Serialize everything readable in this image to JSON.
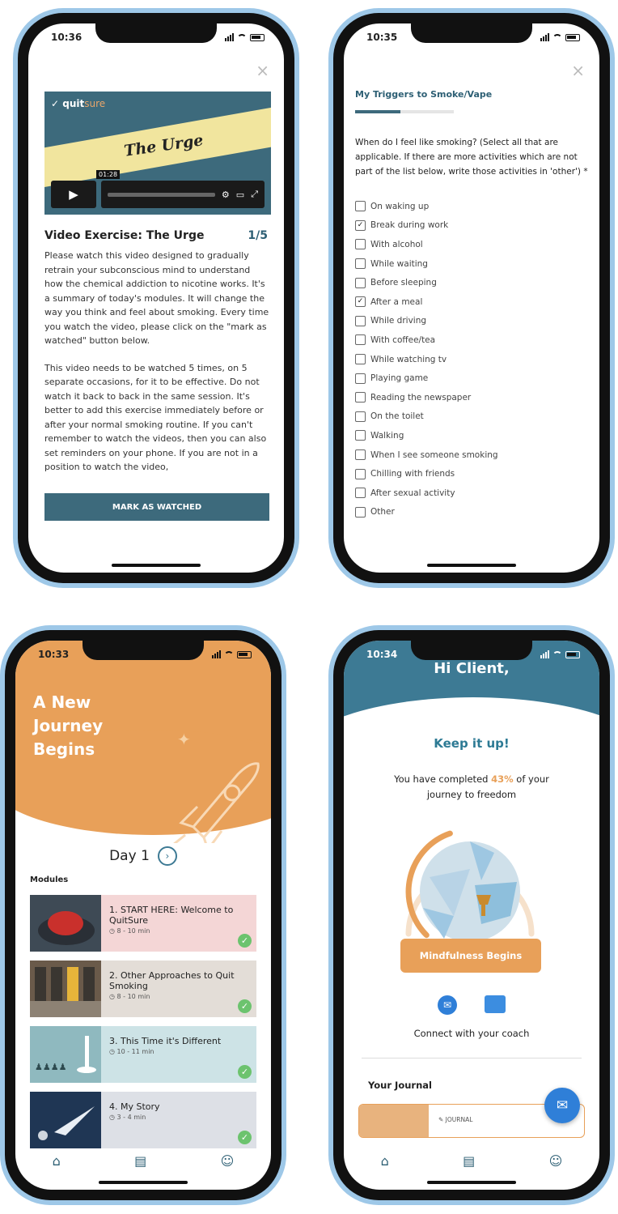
{
  "screen1": {
    "time": "10:36",
    "close_glyph": "×",
    "video": {
      "brand_a": "quit",
      "brand_b": "sure",
      "title": "The Urge",
      "timestamp": "01:28",
      "play_glyph": "▶"
    },
    "heading": "Video Exercise: The Urge",
    "counter": "1/5",
    "paragraph1": "Please watch this video designed to gradually retrain your subconscious mind to understand how the chemical addiction to nicotine works. It's a summary of today's modules. It will change the way you think and feel about smoking. Every time you watch the video, please click on the \"mark as watched\" button below.",
    "paragraph2": "This video needs to be watched 5 times, on 5 separate occasions, for it to be effective. Do not watch it back to back in the same session. It's better to add this exercise immediately before or after your normal smoking routine. If you can't remember to watch the videos, then you can also set reminders on your phone. If you are not in a position to watch the video,",
    "button": "MARK AS WATCHED"
  },
  "screen2": {
    "time": "10:35",
    "close_glyph": "×",
    "title": "My Triggers to Smoke/Vape",
    "question": "When do I feel like smoking? (Select all that are applicable. If there are more activities which are not part of the list below, write those activities in 'other') *",
    "options": [
      {
        "label": "On waking up",
        "checked": false
      },
      {
        "label": "Break during work",
        "checked": true
      },
      {
        "label": "With alcohol",
        "checked": false
      },
      {
        "label": "While waiting",
        "checked": false
      },
      {
        "label": "Before sleeping",
        "checked": false
      },
      {
        "label": "After a meal",
        "checked": true
      },
      {
        "label": "While driving",
        "checked": false
      },
      {
        "label": "With coffee/tea",
        "checked": false
      },
      {
        "label": "While watching tv",
        "checked": false
      },
      {
        "label": "Playing game",
        "checked": false
      },
      {
        "label": "Reading the newspaper",
        "checked": false
      },
      {
        "label": "On the toilet",
        "checked": false
      },
      {
        "label": "Walking",
        "checked": false
      },
      {
        "label": "When I see someone smoking",
        "checked": false
      },
      {
        "label": "Chilling with friends",
        "checked": false
      },
      {
        "label": "After sexual activity",
        "checked": false
      },
      {
        "label": "Other",
        "checked": false
      }
    ]
  },
  "screen3": {
    "time": "10:33",
    "headline_line1": "A New",
    "headline_line2": "Journey",
    "headline_line3": "Begins",
    "day": "Day 1",
    "chevron_glyph": "›",
    "modules_label": "Modules",
    "check_glyph": "✓",
    "modules": [
      {
        "title": "1. START HERE: Welcome to QuitSure",
        "duration": "8 - 10 min",
        "bg": "#f4d6d6"
      },
      {
        "title": "2. Other Approaches to Quit Smoking",
        "duration": "8 - 10 min",
        "bg": "#e3ddd7"
      },
      {
        "title": "3. This Time it's Different",
        "duration": "10 - 11 min",
        "bg": "#cde3e6"
      },
      {
        "title": "4. My Story",
        "duration": "3 - 4 min",
        "bg": "#dde0e6"
      }
    ]
  },
  "screen4": {
    "time": "10:34",
    "greeting": "Hi Client,",
    "keep": "Keep it up!",
    "completed_a": "You have completed ",
    "completed_pct": "43%",
    "completed_b": " of your journey to freedom",
    "progress_fraction": 0.43,
    "milestone": "Mindfulness Begins",
    "connect": "Connect with your coach",
    "journal_label": "Your Journal",
    "journal_tag": "JOURNAL"
  },
  "icons": {
    "home": "home-icon",
    "modules": "modules-icon",
    "profile": "profile-icon",
    "chat": "chat-icon",
    "mail": "mail-icon"
  }
}
